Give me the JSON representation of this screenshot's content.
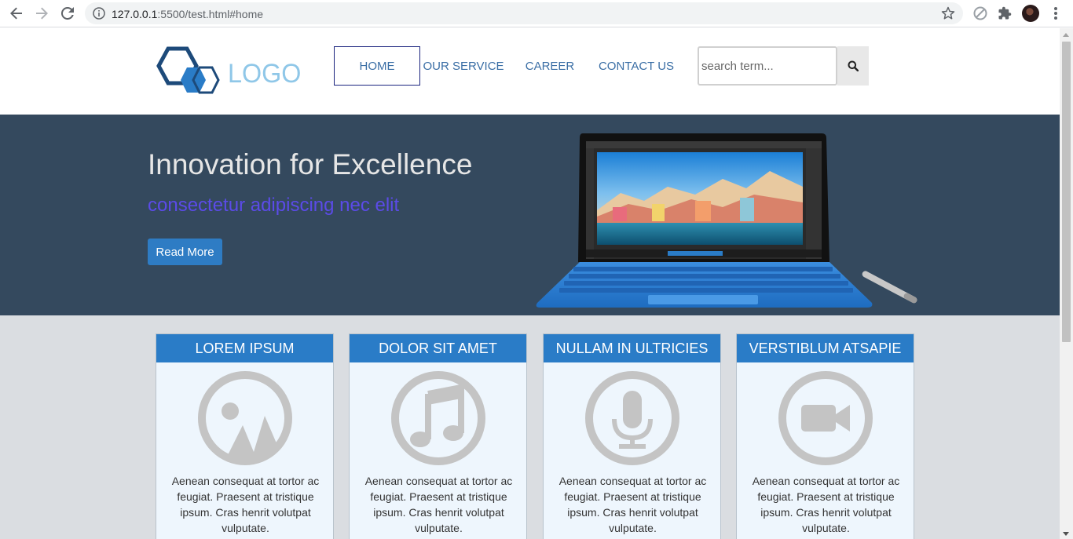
{
  "browser": {
    "url_host": "127.0.0.1",
    "url_rest": ":5500/test.html#home"
  },
  "header": {
    "logo_text": "LOGO",
    "nav": [
      {
        "label": "HOME",
        "active": true
      },
      {
        "label": "OUR SERVICE",
        "active": false
      },
      {
        "label": "CAREER",
        "active": false
      },
      {
        "label": "CONTACT US",
        "active": false
      }
    ],
    "search_placeholder": "search term..."
  },
  "hero": {
    "title": "Innovation for Excellence",
    "subtitle": "consectetur adipiscing nec elit",
    "button_label": "Read More"
  },
  "cards": [
    {
      "title": "LOREM IPSUM",
      "icon": "image-icon",
      "text": "Aenean consequat at tortor ac feugiat. Praesent at tristique ipsum. Cras henrit volutpat vulputate."
    },
    {
      "title": "DOLOR SIT AMET",
      "icon": "music-icon",
      "text": "Aenean consequat at tortor ac feugiat. Praesent at tristique ipsum. Cras henrit volutpat vulputate."
    },
    {
      "title": "NULLAM IN ULTRICIES",
      "icon": "microphone-icon",
      "text": "Aenean consequat at tortor ac feugiat. Praesent at tristique ipsum. Cras henrit volutpat vulputate."
    },
    {
      "title": "VERSTIBLUM ATSAPIE",
      "icon": "video-camera-icon",
      "text": "Aenean consequat at tortor ac feugiat. Praesent at tristique ipsum. Cras henrit volutpat vulputate."
    }
  ],
  "colors": {
    "hero_bg": "#34495e",
    "accent_blue": "#2a7cc7",
    "subtitle_purple": "#5b4be8",
    "icon_gray": "#c4c4c4"
  }
}
